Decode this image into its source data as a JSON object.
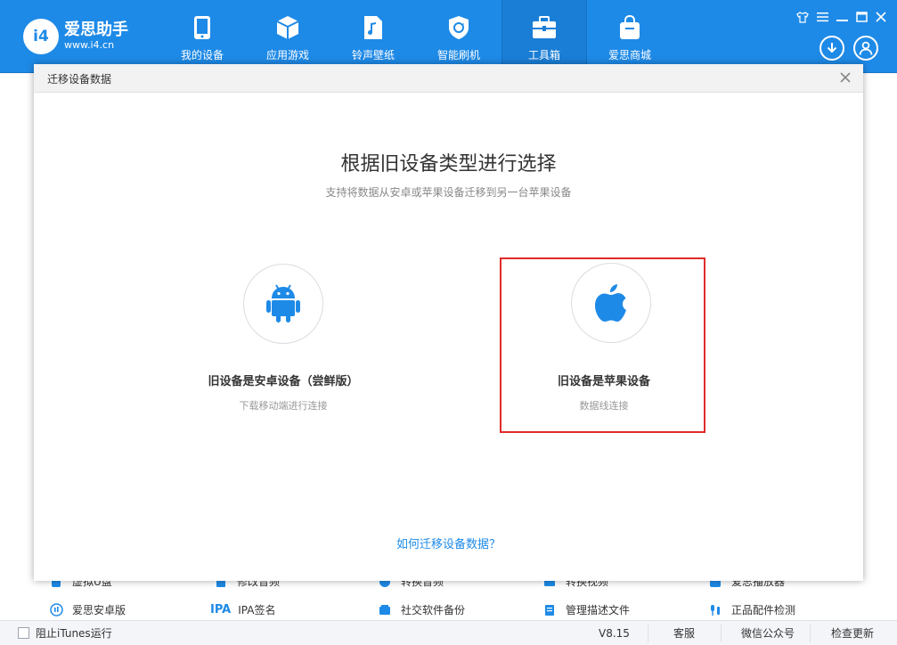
{
  "app": {
    "name": "爱思助手",
    "url": "www.i4.cn",
    "logo_mark": "i4"
  },
  "nav": [
    {
      "label": "我的设备",
      "icon": "phone-icon"
    },
    {
      "label": "应用游戏",
      "icon": "cube-icon"
    },
    {
      "label": "铃声壁纸",
      "icon": "music-file-icon"
    },
    {
      "label": "智能刷机",
      "icon": "refresh-shield-icon"
    },
    {
      "label": "工具箱",
      "icon": "toolbox-icon",
      "active": true
    },
    {
      "label": "爱思商城",
      "icon": "shopping-bag-icon"
    }
  ],
  "window_controls": [
    "shirt-icon",
    "menu-icon",
    "minimize-icon",
    "maximize-icon",
    "close-icon"
  ],
  "header_buttons": [
    "download-icon",
    "user-icon"
  ],
  "background_tools": {
    "row1": [
      "虚拟U盘",
      "修改音频",
      "转换音频",
      "转换视频",
      "爱思播放器"
    ],
    "row2": [
      "爱思安卓版",
      "IPA签名",
      "社交软件备份",
      "管理描述文件",
      "正品配件检测"
    ],
    "row2_ipa_prefix": "IPA"
  },
  "statusbar": {
    "itunes_label": "阻止iTunes运行",
    "version": "V8.15",
    "service": "客服",
    "wechat": "微信公众号",
    "update": "检查更新"
  },
  "dialog": {
    "title": "迁移设备数据",
    "heading": "根据旧设备类型进行选择",
    "subheading": "支持将数据从安卓或苹果设备迁移到另一台苹果设备",
    "options": [
      {
        "title": "旧设备是安卓设备（尝鲜版）",
        "subtitle": "下载移动端进行连接",
        "icon": "android-icon",
        "highlighted": false
      },
      {
        "title": "旧设备是苹果设备",
        "subtitle": "数据线连接",
        "icon": "apple-icon",
        "highlighted": true
      }
    ],
    "help_link": "如何迁移设备数据？"
  },
  "colors": {
    "brand": "#1e8ae7",
    "highlight": "#e02b2b",
    "android_icon": "#1e8ae7",
    "apple_icon": "#1e8ae7"
  }
}
